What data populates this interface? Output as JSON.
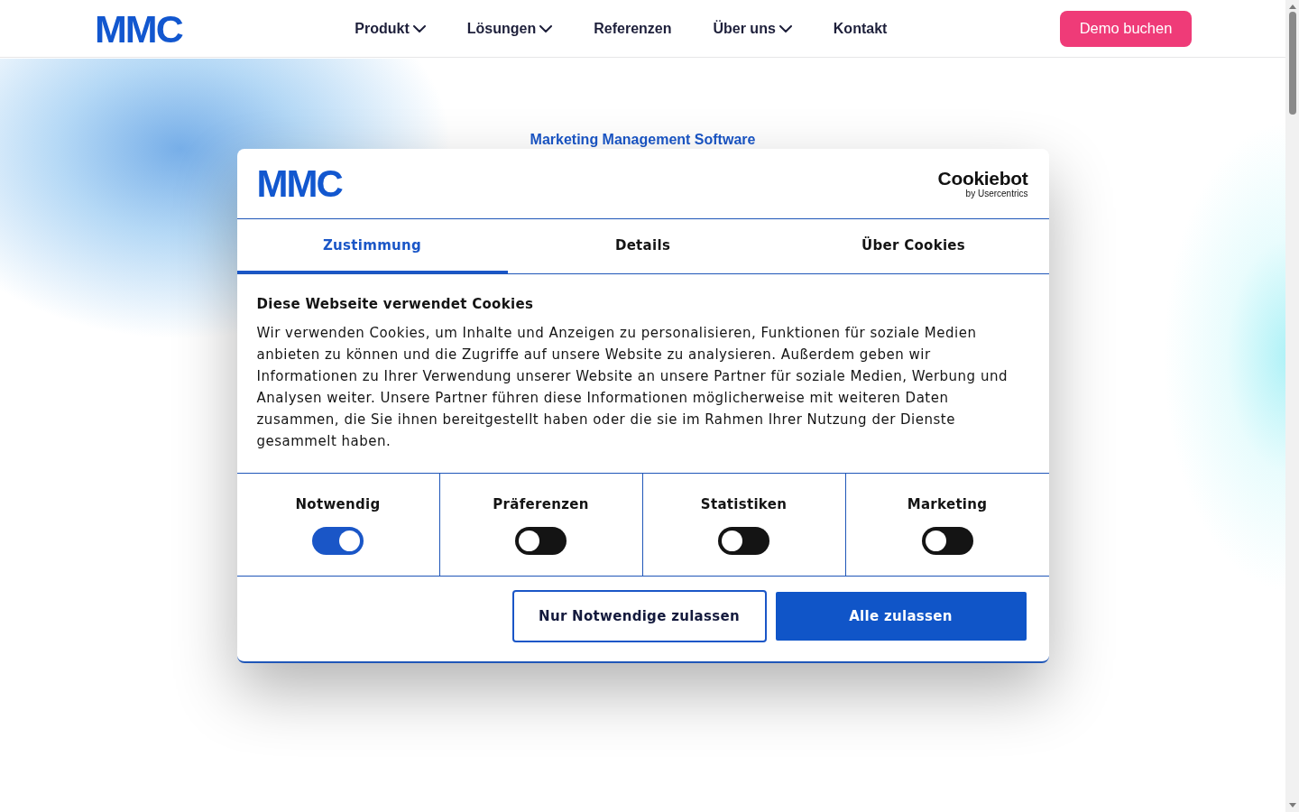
{
  "header": {
    "logo": "MMC",
    "nav": [
      {
        "label": "Produkt",
        "dropdown": true
      },
      {
        "label": "Lösungen",
        "dropdown": true
      },
      {
        "label": "Referenzen",
        "dropdown": false
      },
      {
        "label": "Über uns",
        "dropdown": true
      },
      {
        "label": "Kontakt",
        "dropdown": false
      }
    ],
    "cta": "Demo buchen"
  },
  "hero": {
    "eyebrow": "Marketing Management Software"
  },
  "cookie_dialog": {
    "logo": "MMC",
    "provider_logo": {
      "name": "Cookiebot",
      "byline": "by Usercentrics"
    },
    "tabs": [
      {
        "label": "Zustimmung",
        "selected": true
      },
      {
        "label": "Details",
        "selected": false
      },
      {
        "label": "Über Cookies",
        "selected": false
      }
    ],
    "title": "Diese Webseite verwendet Cookies",
    "text": "Wir verwenden Cookies, um Inhalte und Anzeigen zu personalisieren, Funktionen für soziale Medien anbieten zu können und die Zugriffe auf unsere Website zu analysieren. Außerdem geben wir Informationen zu Ihrer Verwendung unserer Website an unsere Partner für soziale Medien, Werbung und Analysen weiter. Unsere Partner führen diese Informationen möglicherweise mit weiteren Daten zusammen, die Sie ihnen bereitgestellt haben oder die sie im Rahmen Ihrer Nutzung der Dienste gesammelt haben.",
    "categories": [
      {
        "label": "Notwendig",
        "on": true
      },
      {
        "label": "Präferenzen",
        "on": false
      },
      {
        "label": "Statistiken",
        "on": false
      },
      {
        "label": "Marketing",
        "on": false
      }
    ],
    "buttons": [
      {
        "label": "Nur Notwendige zulassen",
        "kind": "outline"
      },
      {
        "label": "Alle zulassen",
        "kind": "primary"
      }
    ]
  }
}
